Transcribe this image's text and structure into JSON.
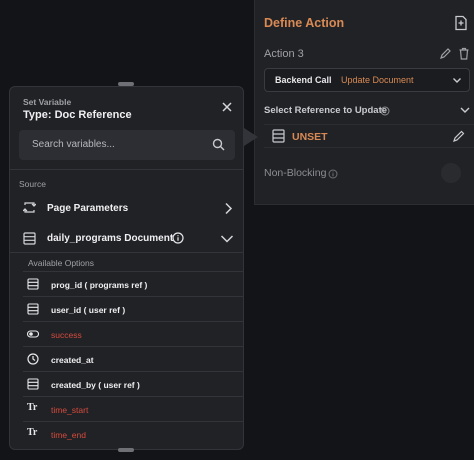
{
  "action_panel": {
    "title": "Define Action",
    "action_label": "Action 3",
    "call_type": "Backend Call",
    "call_value": "Update Document",
    "select_label": "Select Reference to Update",
    "unset_label": "UNSET",
    "non_blocking_label": "Non-Blocking"
  },
  "var_panel": {
    "small_title": "Set Variable",
    "title": "Type: Doc Reference",
    "search_placeholder": "Search variables...",
    "source_label": "Source",
    "page_params_label": "Page Parameters",
    "document_label": "daily_programs Document",
    "available_label": "Available Options",
    "options": [
      {
        "label": "prog_id  ( programs ref )",
        "icon": "table-icon",
        "status": "valid"
      },
      {
        "label": "user_id  ( user ref )",
        "icon": "table-icon",
        "status": "valid"
      },
      {
        "label": "success",
        "icon": "toggle-icon",
        "status": "invalid"
      },
      {
        "label": "created_at",
        "icon": "clock-icon",
        "status": "valid"
      },
      {
        "label": "created_by  ( user ref )",
        "icon": "table-icon",
        "status": "valid"
      },
      {
        "label": "time_start",
        "icon": "text-type-icon",
        "status": "invalid"
      },
      {
        "label": "time_end",
        "icon": "text-type-icon",
        "status": "invalid"
      }
    ]
  },
  "colors": {
    "accent": "#d98a54",
    "invalid": "#d64b3c",
    "panel": "#212226",
    "background": "#131417"
  }
}
